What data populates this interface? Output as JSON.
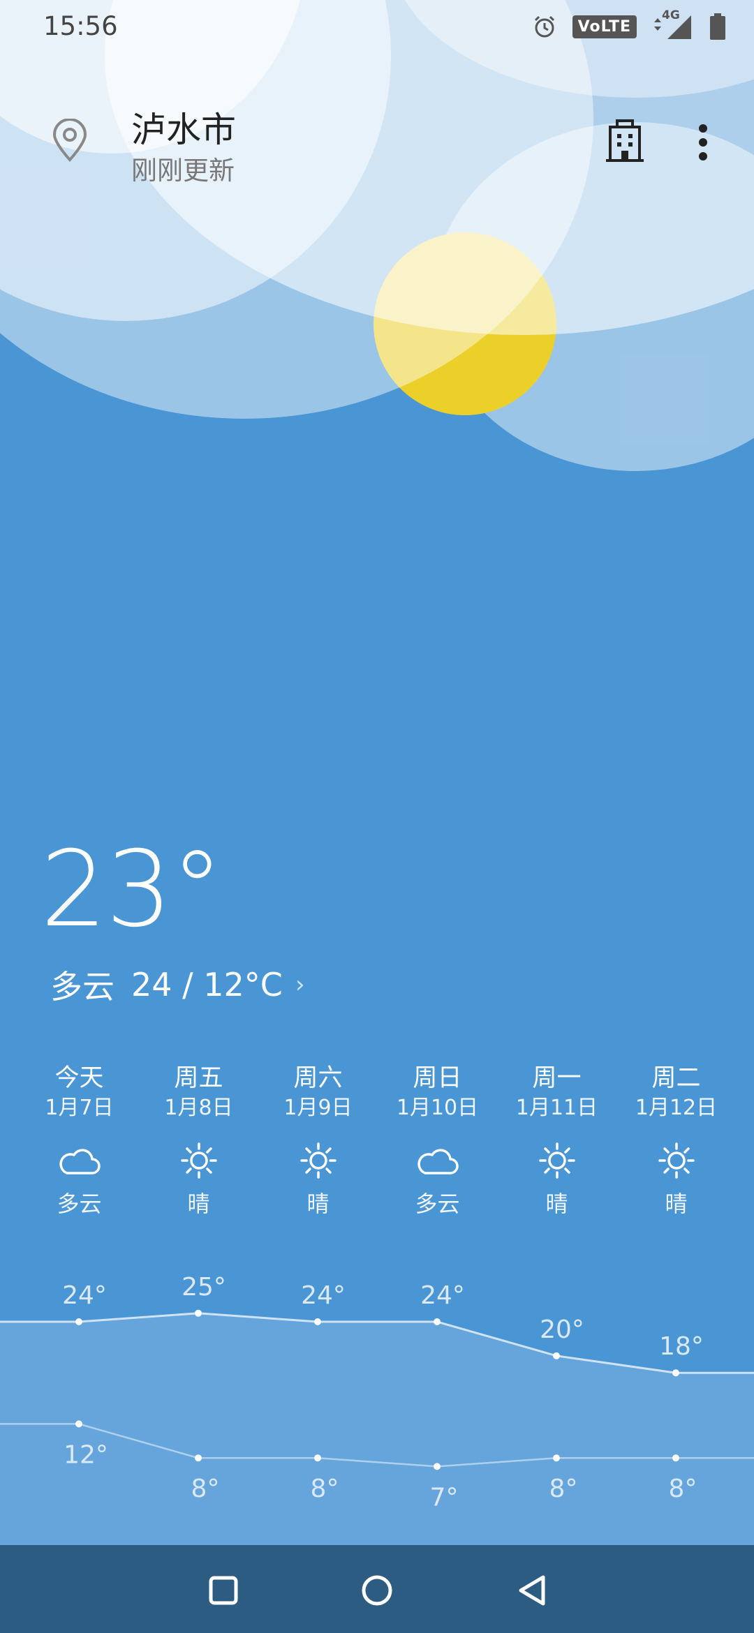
{
  "status_bar": {
    "time": "15:56",
    "alarm_icon": "alarm-clock-icon",
    "volte": "VoLTE",
    "network": "4G",
    "signal_icon": "signal-icon",
    "battery_icon": "battery-icon"
  },
  "header": {
    "location_icon": "location-pin-icon",
    "city": "泸水市",
    "updated": "刚刚更新",
    "city_manage_icon": "building-icon",
    "menu_icon": "more-vertical-icon"
  },
  "current": {
    "temperature": "23°",
    "condition": "多云",
    "range": "24 / 12°C",
    "more": "›"
  },
  "forecast": [
    {
      "day": "今天",
      "date": "1月7日",
      "icon": "cloud-icon",
      "condition": "多云"
    },
    {
      "day": "周五",
      "date": "1月8日",
      "icon": "sun-icon",
      "condition": "晴"
    },
    {
      "day": "周六",
      "date": "1月9日",
      "icon": "sun-icon",
      "condition": "晴"
    },
    {
      "day": "周日",
      "date": "1月10日",
      "icon": "cloud-icon",
      "condition": "多云"
    },
    {
      "day": "周一",
      "date": "1月11日",
      "icon": "sun-icon",
      "condition": "晴"
    },
    {
      "day": "周二",
      "date": "1月12日",
      "icon": "sun-icon",
      "condition": "晴"
    }
  ],
  "chart_data": {
    "type": "line",
    "categories": [
      "1月7日",
      "1月8日",
      "1月9日",
      "1月10日",
      "1月11日",
      "1月12日"
    ],
    "series": [
      {
        "values": [
          24,
          25,
          24,
          24,
          20,
          18
        ],
        "labels": [
          "24°",
          "25°",
          "24°",
          "24°",
          "20°",
          "18°"
        ]
      },
      {
        "values": [
          12,
          8,
          8,
          7,
          8,
          8
        ],
        "labels": [
          "12°",
          "8°",
          "8°",
          "7°",
          "8°",
          "8°"
        ]
      }
    ],
    "colors": {
      "line": "#cfe3f5",
      "fill": "#6aa8dc",
      "label_high": "#dbe9f6",
      "label_low": "#dbe9f6"
    }
  },
  "navbar": {
    "recents_icon": "square-recents-icon",
    "home_icon": "circle-home-icon",
    "back_icon": "triangle-back-icon"
  },
  "colors": {
    "sky": "#4a95d3",
    "sun": "#f0cf2c",
    "navbar": "#2c5c82"
  }
}
